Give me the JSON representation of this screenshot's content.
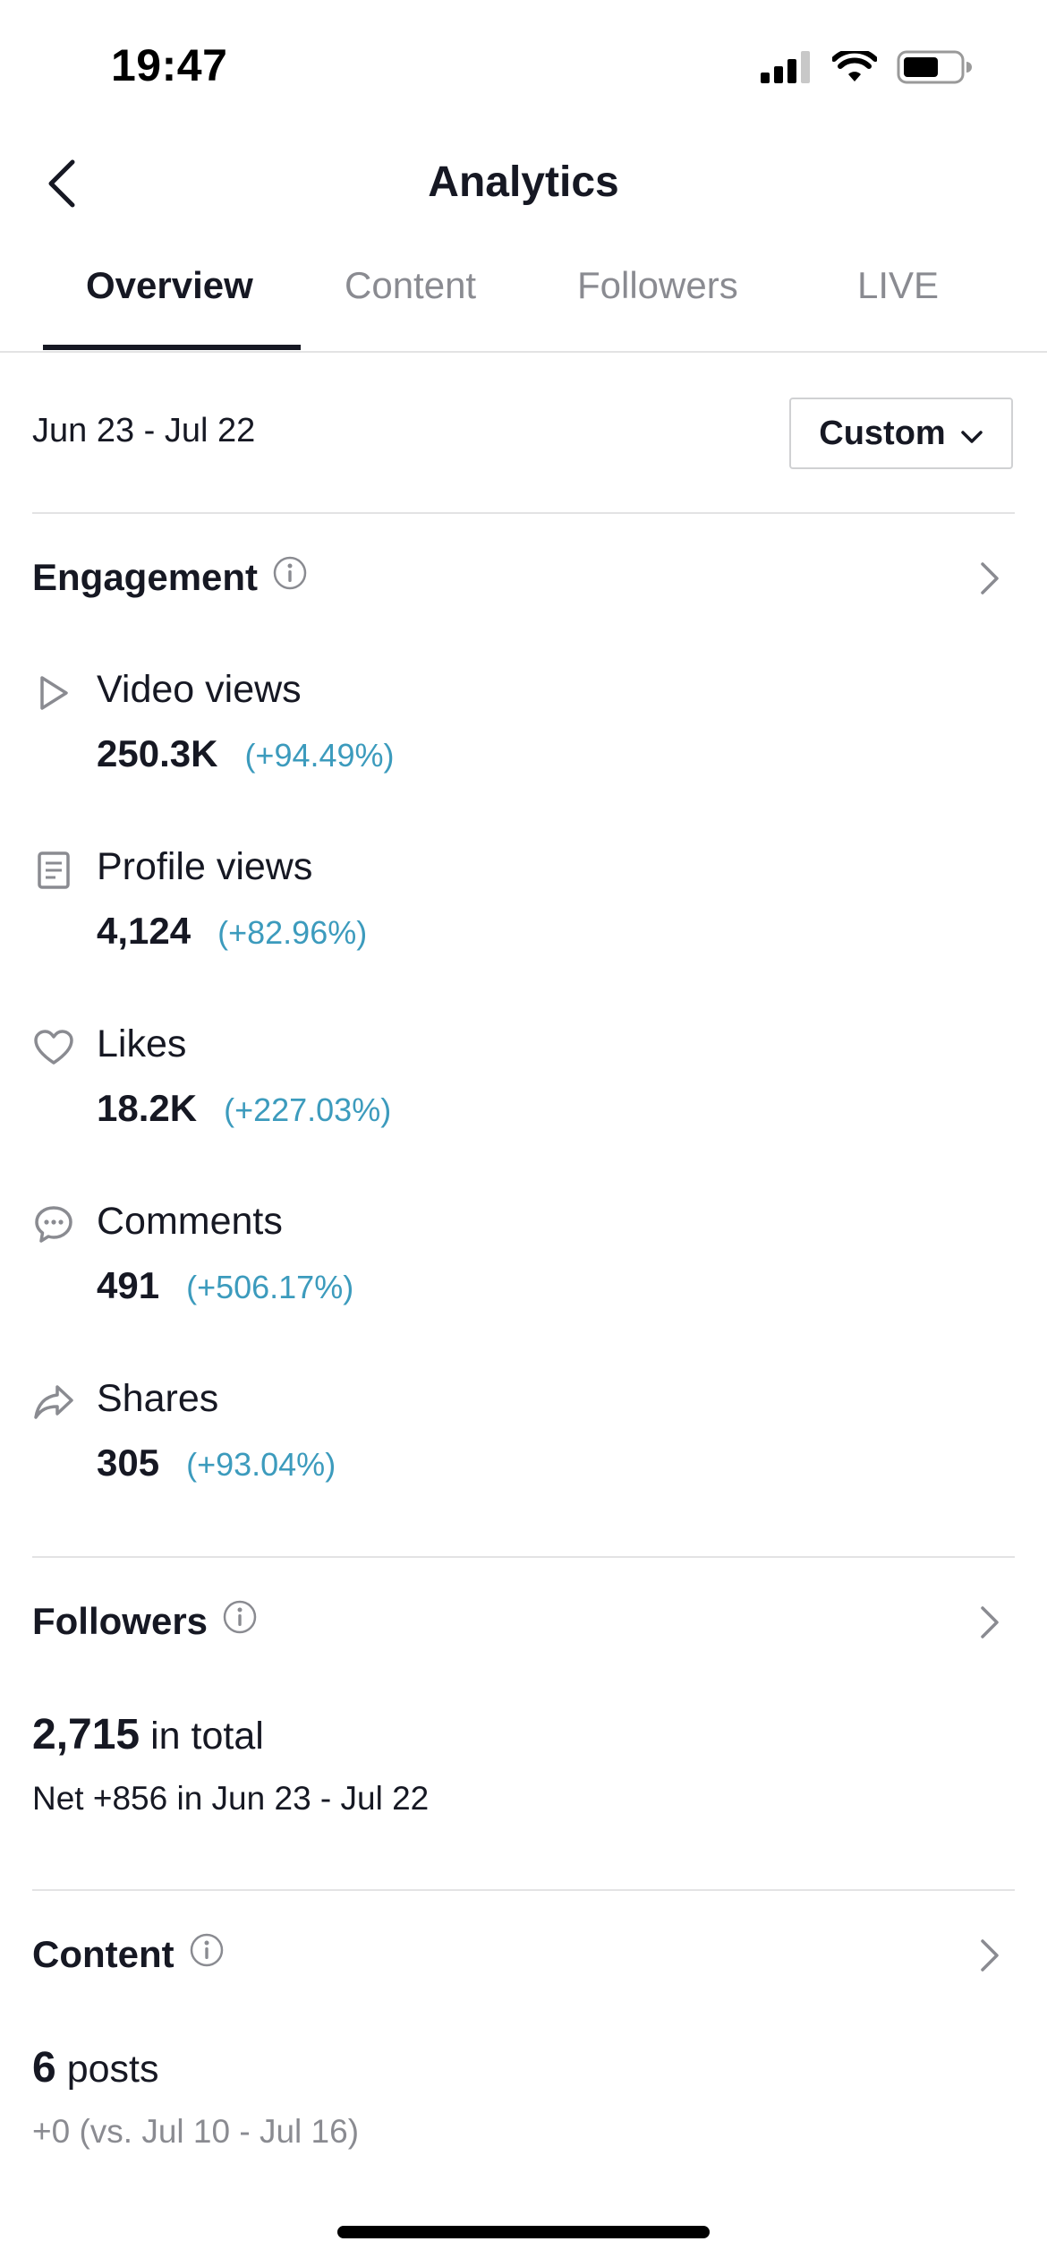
{
  "status_bar": {
    "time": "19:47"
  },
  "header": {
    "title": "Analytics"
  },
  "tabs": [
    {
      "label": "Overview",
      "active": true
    },
    {
      "label": "Content",
      "active": false
    },
    {
      "label": "Followers",
      "active": false
    },
    {
      "label": "LIVE",
      "active": false
    }
  ],
  "date_filter": {
    "range": "Jun 23 - Jul 22",
    "button_label": "Custom"
  },
  "engagement": {
    "title": "Engagement",
    "metrics": [
      {
        "icon": "play-icon",
        "label": "Video views",
        "value": "250.3K",
        "change": "(+94.49%)"
      },
      {
        "icon": "profile-doc-icon",
        "label": "Profile views",
        "value": "4,124",
        "change": "(+82.96%)"
      },
      {
        "icon": "heart-icon",
        "label": "Likes",
        "value": "18.2K",
        "change": "(+227.03%)"
      },
      {
        "icon": "comment-icon",
        "label": "Comments",
        "value": "491",
        "change": "(+506.17%)"
      },
      {
        "icon": "share-icon",
        "label": "Shares",
        "value": "305",
        "change": "(+93.04%)"
      }
    ]
  },
  "followers": {
    "title": "Followers",
    "total": "2,715",
    "total_suffix": "in total",
    "net": "Net +856 in Jun 23 - Jul 22"
  },
  "content": {
    "title": "Content",
    "posts": "6",
    "posts_suffix": "posts",
    "comparison": "+0 (vs. Jul 10 - Jul 16)"
  },
  "colors": {
    "text_primary": "#161823",
    "text_muted": "#8a8b91",
    "change_positive": "#3c9bbd",
    "divider": "#e3e3e4"
  }
}
